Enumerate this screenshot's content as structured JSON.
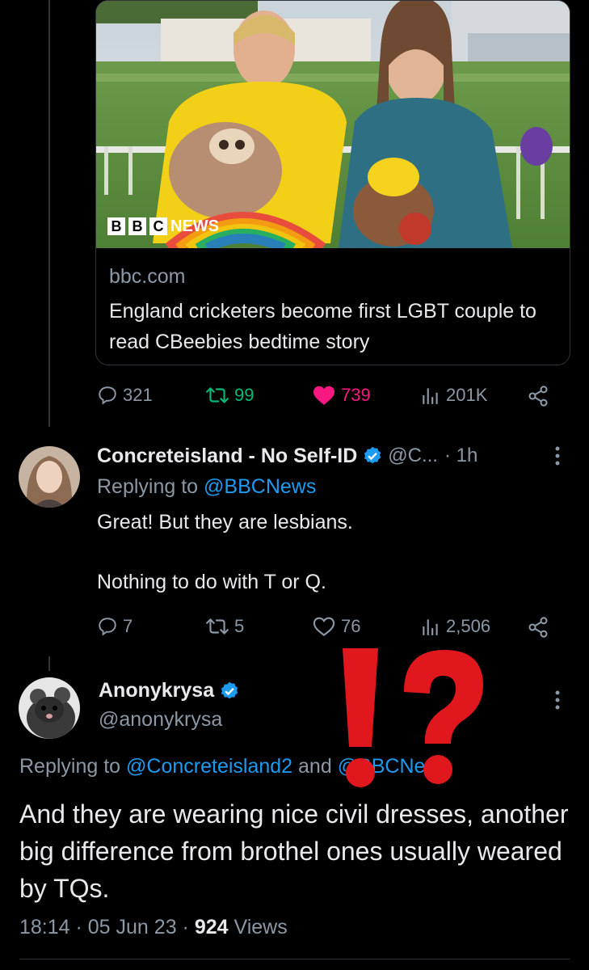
{
  "card": {
    "brand_boxes": [
      "B",
      "B",
      "C"
    ],
    "brand_word": "NEWS",
    "domain": "bbc.com",
    "title": "England cricketers become first LGBT couple to read CBeebies bedtime story"
  },
  "parent_metrics": {
    "replies": "321",
    "retweets": "99",
    "likes": "739",
    "views": "201K",
    "like_color": "#f91880",
    "retweet_color": "#00ba7c"
  },
  "reply1": {
    "display_name": "Concreteisland - No Self-ID",
    "handle": "@C...",
    "time": "· 1h",
    "replying_prefix": "Replying to",
    "replying_to": "@BBCNews",
    "text_line1": "Great! But they are lesbians.",
    "text_line2": "Nothing to do with T or Q.",
    "replies": "7",
    "retweets": "5",
    "likes": "76",
    "views": "2,506"
  },
  "reply2": {
    "display_name": "Anonykrysa",
    "handle": "@anonykrysa",
    "replying_prefix": "Replying to",
    "replying_to_1": "@Concreteisland2",
    "replying_mid": "and",
    "replying_to_2": "@BBCNews",
    "text": "And they are wearing nice civil dresses, another big difference from brothel ones usually weared by TQs.",
    "time": "18:14 · 05 Jun 23 ·",
    "views_count": "924",
    "views_label": "Views"
  },
  "overlay": {
    "exclamation_color": "#e0181e"
  },
  "colors": {
    "accent": "#1d9bf0",
    "muted": "#8b98a5",
    "text": "#e7e9ea",
    "verified": "#1d9bf0"
  }
}
